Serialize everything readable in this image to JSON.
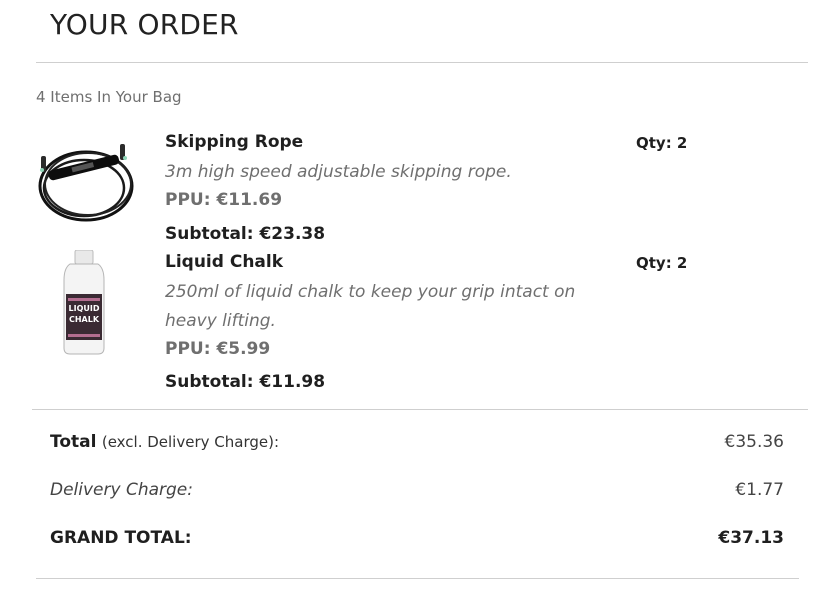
{
  "header": {
    "title": "YOUR ORDER"
  },
  "bag": {
    "count_text": "4 Items In Your Bag"
  },
  "items": [
    {
      "name": "Skipping Rope",
      "description": "3m high speed adjustable skipping rope.",
      "ppu": "PPU: €11.69",
      "subtotal": "Subtotal: €23.38",
      "qty": "Qty: 2",
      "image_icon": "skipping-rope-icon"
    },
    {
      "name": "Liquid Chalk",
      "description": "250ml of liquid chalk to keep your grip intact on heavy lifting.",
      "ppu": "PPU: €5.99",
      "subtotal": "Subtotal: €11.98",
      "qty": "Qty: 2",
      "image_icon": "chalk-bottle-icon",
      "label_text": "LIQUID CHALK"
    }
  ],
  "summary": {
    "total_label": "Total",
    "total_note": "(excl. Delivery Charge):",
    "total_value": "€35.36",
    "delivery_label": "Delivery Charge:",
    "delivery_value": "€1.77",
    "grand_label": "GRAND TOTAL:",
    "grand_value": "€37.13"
  },
  "colors": {
    "text": "#1f1f1f",
    "muted": "#6f6f6f",
    "rule": "#cfcfcf"
  }
}
